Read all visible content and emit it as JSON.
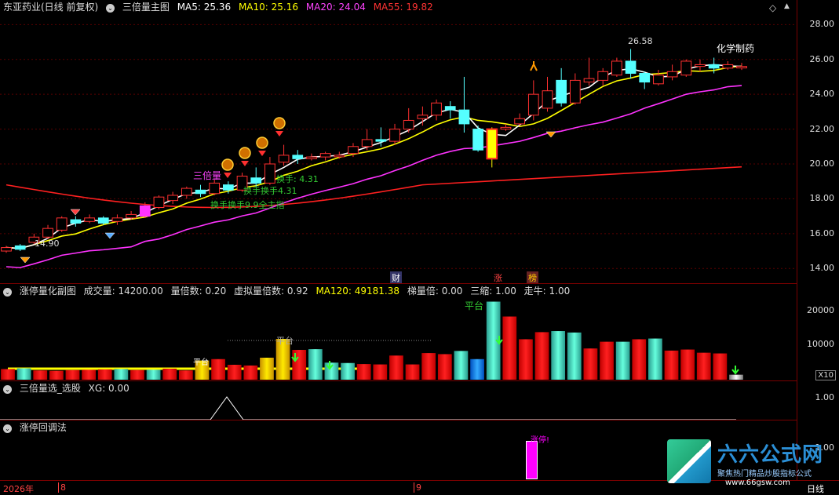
{
  "main": {
    "stock_name": "东亚药业(日线 前复权)",
    "indicator": "三倍量主图",
    "ma": [
      {
        "label": "MA5: 25.36",
        "color": "#ffffff"
      },
      {
        "label": "MA10: 25.16",
        "color": "#ffff00"
      },
      {
        "label": "MA20: 24.04",
        "color": "#ff44ff"
      },
      {
        "label": "MA55: 19.82",
        "color": "#ff3030"
      }
    ],
    "y_ticks": [
      "28.00",
      "26.00",
      "24.00",
      "22.00",
      "20.00",
      "18.00",
      "16.00",
      "14.00"
    ],
    "sector_label": "化学制药",
    "high_label": "26.58",
    "low_label": "14.90",
    "three_label": "三倍量",
    "turnover_a": "换手: 4.31",
    "turnover_b": "换手换手4.31",
    "turnover_c": "换手换手9.9全主指",
    "markers": [
      "财",
      "涨",
      "榜"
    ],
    "top_icons": [
      "◇",
      "▲"
    ]
  },
  "sub1": {
    "title": "涨停量化副图",
    "values": [
      "成交量: 14200.00",
      "量倍数: 0.20",
      "虚拟量倍数: 0.92",
      "MA120: 49181.38",
      "梯量倍: 0.00",
      "三缩: 1.00",
      "走牛: 1.00"
    ],
    "y_ticks": [
      "20000",
      "10000"
    ],
    "scale": "X10",
    "platform_a": "平台",
    "platform_b": "平台",
    "small_label": "平台"
  },
  "sub2": {
    "title": "三倍量选_选股",
    "value": "XG: 0.00",
    "y_tick": "1.00"
  },
  "sub3": {
    "title": "涨停回调法",
    "y_tick": "1.00",
    "bar_label": "涨停!"
  },
  "bottom": {
    "year": "2026年",
    "month_a": "8",
    "month_b": "9",
    "period": "日线"
  },
  "watermark": {
    "brand": "六六公式网",
    "slogan": "聚焦热门精品炒股指标公式",
    "url": "www.66gsw.com"
  },
  "chart_data": {
    "type": "candlestick",
    "ylim": [
      13.2,
      28.6
    ],
    "candles": [
      [
        15.0,
        15.2,
        14.9,
        15.3
      ],
      [
        15.3,
        15.1,
        15.0,
        15.4
      ],
      [
        15.5,
        15.8,
        15.4,
        16.0
      ],
      [
        15.8,
        16.3,
        15.7,
        16.5
      ],
      [
        16.2,
        16.9,
        16.1,
        17.0
      ],
      [
        16.8,
        16.6,
        16.4,
        17.0
      ],
      [
        16.7,
        16.9,
        16.6,
        17.1
      ],
      [
        16.9,
        16.6,
        16.5,
        17.0
      ],
      [
        16.7,
        16.9,
        16.5,
        17.1
      ],
      [
        16.9,
        17.1,
        16.8,
        17.3
      ],
      [
        17.0,
        17.6,
        16.9,
        17.8
      ],
      [
        17.5,
        18.1,
        17.4,
        18.2
      ],
      [
        17.9,
        18.2,
        17.7,
        18.4
      ],
      [
        18.2,
        18.6,
        18.0,
        18.7
      ],
      [
        18.5,
        18.3,
        18.1,
        18.8
      ],
      [
        18.3,
        18.9,
        18.2,
        19.1
      ],
      [
        18.8,
        18.5,
        18.3,
        19.0
      ],
      [
        18.5,
        19.3,
        18.4,
        19.5
      ],
      [
        19.2,
        18.9,
        18.7,
        19.8
      ],
      [
        18.9,
        20.0,
        18.8,
        20.4
      ],
      [
        20.1,
        20.5,
        19.9,
        21.1
      ],
      [
        20.5,
        20.3,
        20.0,
        20.8
      ],
      [
        20.3,
        20.4,
        20.2,
        20.6
      ],
      [
        20.4,
        20.6,
        20.2,
        20.7
      ],
      [
        20.5,
        20.5,
        20.3,
        20.7
      ],
      [
        20.6,
        21.0,
        20.4,
        21.2
      ],
      [
        21.0,
        21.4,
        20.8,
        22.0
      ],
      [
        21.4,
        21.3,
        21.0,
        22.1
      ],
      [
        21.3,
        22.0,
        21.1,
        22.3
      ],
      [
        22.0,
        22.5,
        21.8,
        23.2
      ],
      [
        22.6,
        22.8,
        22.2,
        23.3
      ],
      [
        22.8,
        23.5,
        22.5,
        23.7
      ],
      [
        23.3,
        23.1,
        22.6,
        23.6
      ],
      [
        23.1,
        22.3,
        21.8,
        25.0
      ],
      [
        22.0,
        20.8,
        20.7,
        22.2
      ],
      [
        20.3,
        22.0,
        19.8,
        22.1
      ],
      [
        22.0,
        22.1,
        21.9,
        22.3
      ],
      [
        22.3,
        22.6,
        22.2,
        22.9
      ],
      [
        22.8,
        24.0,
        22.5,
        24.8
      ],
      [
        23.2,
        24.2,
        23.0,
        25.0
      ],
      [
        24.8,
        23.5,
        23.3,
        25.5
      ],
      [
        23.5,
        24.8,
        23.4,
        25.2
      ],
      [
        24.7,
        24.9,
        24.5,
        26.1
      ],
      [
        24.8,
        25.3,
        24.5,
        25.5
      ],
      [
        25.1,
        25.9,
        25.0,
        26.1
      ],
      [
        25.9,
        25.2,
        24.9,
        26.6
      ],
      [
        25.2,
        24.7,
        24.3,
        25.3
      ],
      [
        24.6,
        25.1,
        24.5,
        25.4
      ],
      [
        25.0,
        25.3,
        24.8,
        25.7
      ],
      [
        25.1,
        25.9,
        25.0,
        26.0
      ],
      [
        25.6,
        25.7,
        25.3,
        26.0
      ],
      [
        25.7,
        25.5,
        25.2,
        26.1
      ],
      [
        25.5,
        25.7,
        25.4,
        25.9
      ],
      [
        25.6,
        25.6,
        25.4,
        25.8
      ]
    ],
    "volume_ylim": [
      0,
      23000
    ],
    "volume": [
      3000,
      3200,
      2600,
      2500,
      2700,
      2800,
      2900,
      3000,
      2700,
      2800,
      3100,
      2600,
      5400,
      5800,
      4200,
      4000,
      6200,
      11500,
      8400,
      8600,
      4800,
      4700,
      4400,
      4300,
      6800,
      4300,
      7500,
      7200,
      8100,
      5800,
      22000,
      17800,
      11400,
      13400,
      13700,
      13300,
      8800,
      10700,
      10700,
      11400,
      11600,
      8200,
      8500,
      7600,
      7400,
      1400
    ],
    "volume_color": [
      "r",
      "c",
      "r",
      "r",
      "r",
      "r",
      "r",
      "c",
      "r",
      "c",
      "r",
      "r",
      "y",
      "r",
      "r",
      "r",
      "y",
      "y",
      "r",
      "c",
      "c",
      "c",
      "r",
      "r",
      "r",
      "r",
      "r",
      "r",
      "c",
      "b",
      "c",
      "r",
      "r",
      "r",
      "c",
      "c",
      "r",
      "r",
      "c",
      "r",
      "c",
      "r",
      "r",
      "r",
      "r",
      "w"
    ]
  }
}
